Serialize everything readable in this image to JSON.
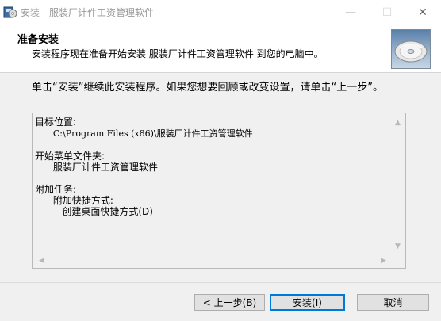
{
  "window": {
    "title": "安装 - 服装厂计件工资管理软件",
    "minimize_glyph": "—",
    "maximize_glyph": "☐",
    "close_glyph": "✕"
  },
  "header": {
    "title": "准备安装",
    "subtitle": "安装程序现在准备开始安装 服装厂计件工资管理软件 到您的电脑中。",
    "image_icon": "cd-disc-icon"
  },
  "main": {
    "description": "单击“安装”继续此安装程序。如果您想要回顾或改变设置，请单击“上一步”。",
    "memo": {
      "dest_label": "目标位置:",
      "dest_value": "C:\\Program Files (x86)\\服装厂计件工资管理软件",
      "start_menu_label": "开始菜单文件夹:",
      "start_menu_value": "服装厂计件工资管理软件",
      "tasks_label": "附加任务:",
      "tasks_group": "附加快捷方式:",
      "tasks_item": "创建桌面快捷方式(D)"
    }
  },
  "footer": {
    "back_label": "< 上一步(B)",
    "install_label": "安装(I)",
    "cancel_label": "取消"
  },
  "colors": {
    "accent": "#0078d7",
    "panel_bg": "#f0f0f0",
    "button_bg": "#e1e1e1"
  }
}
